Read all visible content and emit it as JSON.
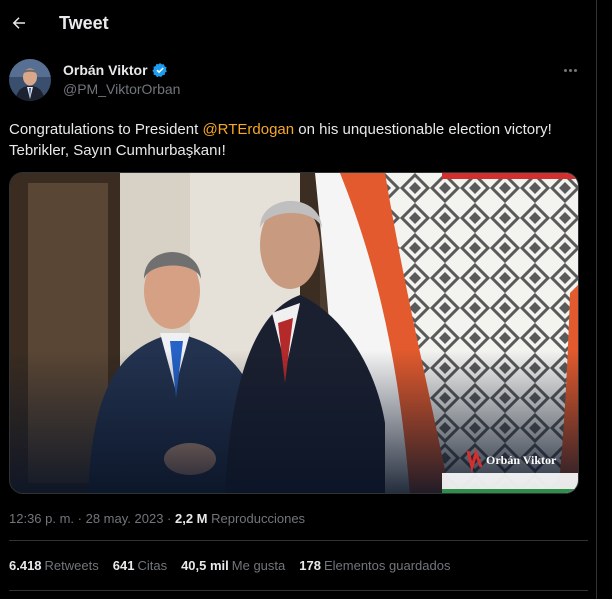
{
  "header": {
    "title": "Tweet",
    "back_icon": "arrow-left-icon"
  },
  "author": {
    "name": "Orbán Viktor",
    "handle": "@PM_ViktorOrban",
    "verified": true,
    "verified_color": "#1d9bf0"
  },
  "tweet": {
    "text_before": "Congratulations to President ",
    "mention": "@RTErdogan",
    "text_after": " on his unquestionable election victory!",
    "line2": "Tebrikler, Sayın Cumhurbaşkanı!",
    "mention_color": "#f7a824"
  },
  "media": {
    "watermark": "Orbán Viktor"
  },
  "meta": {
    "time": "12:36 p. m.",
    "sep1": " · ",
    "date": "28 may. 2023",
    "sep2": " · ",
    "views_num": "2,2 M",
    "views_label": " Reproducciones"
  },
  "stats": [
    {
      "num": "6.418",
      "label": "Retweets"
    },
    {
      "num": "641",
      "label": "Citas"
    },
    {
      "num": "40,5 mil",
      "label": "Me gusta"
    },
    {
      "num": "178",
      "label": "Elementos guardados"
    }
  ]
}
